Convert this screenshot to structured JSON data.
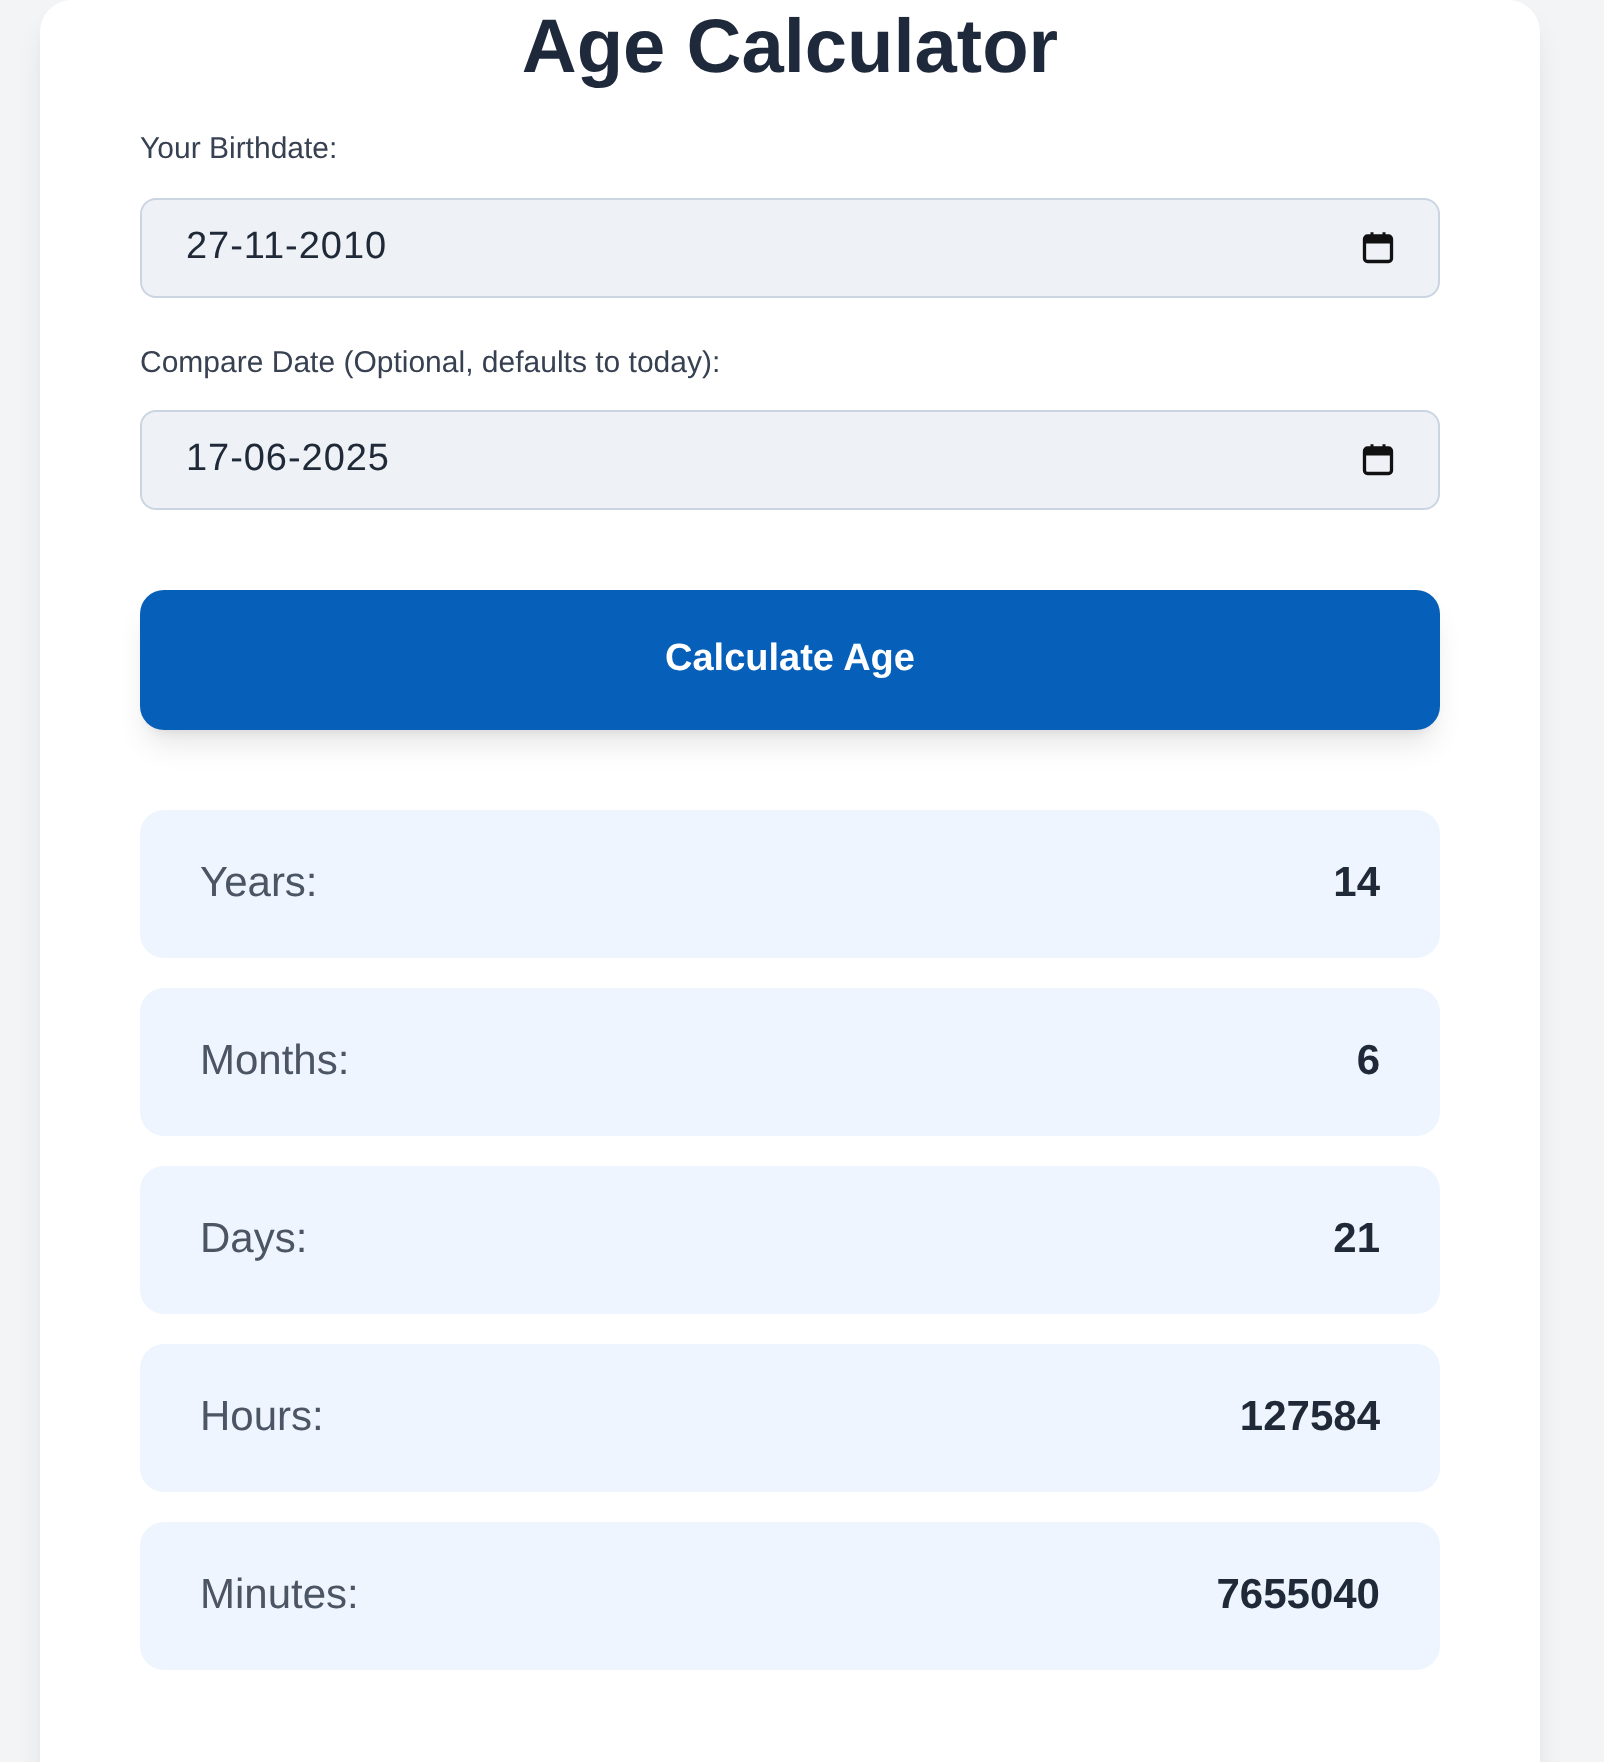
{
  "title": "Age Calculator",
  "fields": [
    {
      "label": "Your Birthdate:",
      "value": "27-11-2010"
    },
    {
      "label": "Compare Date (Optional, defaults to today):",
      "value": "17-06-2025"
    }
  ],
  "button": "Calculate Age",
  "results": [
    {
      "label": "Years:",
      "value": "14"
    },
    {
      "label": "Months:",
      "value": "6"
    },
    {
      "label": "Days:",
      "value": "21"
    },
    {
      "label": "Hours:",
      "value": "127584"
    },
    {
      "label": "Minutes:",
      "value": "7655040"
    }
  ]
}
